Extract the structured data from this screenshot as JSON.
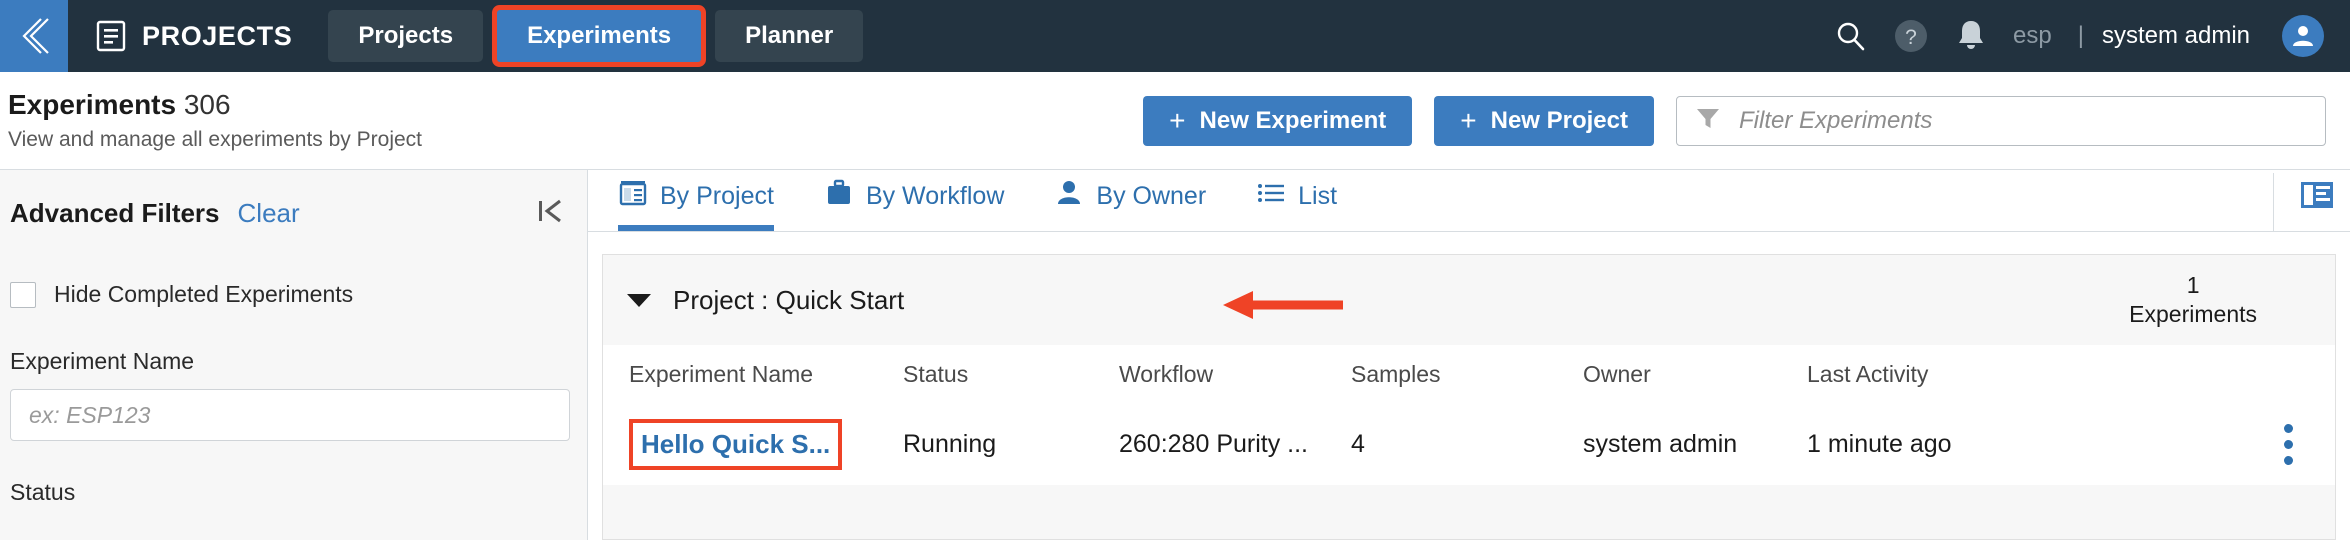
{
  "topbar": {
    "back_icon": "double-chevron-left-icon",
    "app_icon": "document-folder-icon",
    "brand": "PROJECTS",
    "tabs": [
      {
        "label": "Projects",
        "state": "inactive"
      },
      {
        "label": "Experiments",
        "state": "active-highlighted"
      },
      {
        "label": "Planner",
        "state": "inactive"
      }
    ],
    "actions": [
      {
        "name": "search-icon",
        "glyph": "search"
      },
      {
        "name": "help-icon",
        "glyph": "question-mark"
      },
      {
        "name": "notifications-icon",
        "glyph": "bell"
      }
    ],
    "org": "esp",
    "separator": "|",
    "user": "system admin",
    "avatar_icon": "user-avatar-icon"
  },
  "subheader": {
    "title": "Experiments",
    "count": "306",
    "subtitle": "View and manage all experiments by Project",
    "new_experiment_label": "New Experiment",
    "new_project_label": "New Project",
    "plus": "+",
    "filter_placeholder": "Filter Experiments",
    "filter_value": "",
    "filter_icon": "funnel-icon"
  },
  "sidebar": {
    "title": "Advanced Filters",
    "clear_label": "Clear",
    "collapse_icon": "collapse-panel-left-icon",
    "hide_completed_label": "Hide Completed Experiments",
    "hide_completed_checked": false,
    "experiment_name_label": "Experiment Name",
    "experiment_name_placeholder": "ex: ESP123",
    "experiment_name_value": "",
    "status_label": "Status"
  },
  "main": {
    "view_tabs": [
      {
        "label": "By Project",
        "icon": "by-project-icon",
        "active": true
      },
      {
        "label": "By Workflow",
        "icon": "briefcase-icon",
        "active": false
      },
      {
        "label": "By Owner",
        "icon": "person-icon",
        "active": false
      },
      {
        "label": "List",
        "icon": "list-icon",
        "active": false
      }
    ],
    "layout_toggle_icon": "panel-layout-icon",
    "group": {
      "title": "Project : Quick Start",
      "count": "1",
      "count_label": "Experiments",
      "expanded": true,
      "annotation": "red-arrow-pointing-left"
    },
    "table": {
      "columns": [
        "Experiment Name",
        "Status",
        "Workflow",
        "Samples",
        "Owner",
        "Last Activity"
      ],
      "rows": [
        {
          "name": "Hello Quick S...",
          "status": "Running",
          "workflow": "260:280 Purity ...",
          "samples": "4",
          "owner": "system admin",
          "last_activity": "1 minute ago",
          "menu_icon": "kebab-menu-icon",
          "highlighted": true
        }
      ]
    }
  },
  "colors": {
    "nav_bg": "#22323f",
    "accent": "#3c7cbf",
    "annotation": "#ef4326",
    "link": "#2d6fad",
    "panel_bg": "#f7f7f7"
  }
}
